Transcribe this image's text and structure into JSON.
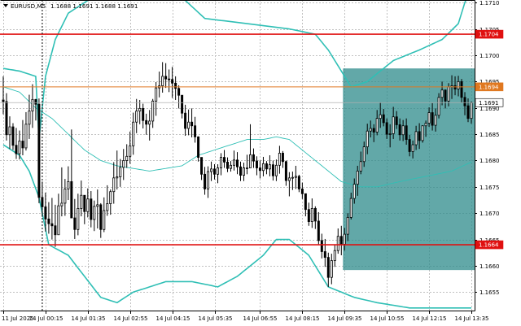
{
  "window": {
    "title_symbol": "EURUSD,M5",
    "title_prices": "1.1688 1.1691 1.1688 1.1691"
  },
  "colors": {
    "background": "#ffffff",
    "grid": "#c0c0c0",
    "candle": "#000000",
    "bollinger": "#2fbfb5",
    "moving_average": "#2fbfb5",
    "support_resistance": "#e01010",
    "level_orange": "#e07820",
    "current_price_line": "#b0b0b0",
    "highlight_box": "#2e8b8b"
  },
  "chart_data": {
    "type": "candlestick",
    "symbol": "EURUSD",
    "timeframe": "M5",
    "ylim": [
      1.16515,
      1.17105
    ],
    "y_ticks": [
      "1.1710",
      "1.1705",
      "1.1700",
      "1.1695",
      "1.1690",
      "1.1685",
      "1.1680",
      "1.1675",
      "1.1670",
      "1.1665",
      "1.1660",
      "1.1655"
    ],
    "x_ticks": [
      "11 Jul 2025",
      "14 Jul 00:15",
      "14 Jul 01:35",
      "14 Jul 02:55",
      "14 Jul 04:15",
      "14 Jul 05:35",
      "14 Jul 06:55",
      "14 Jul 08:15",
      "14 Jul 09:35",
      "14 Jul 10:55",
      "14 Jul 12:15",
      "14 Jul 13:35"
    ],
    "horizontal_levels": [
      {
        "price": 1.1704,
        "label": "1.1704",
        "style": "red"
      },
      {
        "price": 1.1694,
        "label": "1.1694",
        "style": "orange"
      },
      {
        "price": 1.1664,
        "label": "1.1664",
        "style": "red"
      },
      {
        "price": 1.1691,
        "label": "1.1691",
        "style": "current"
      }
    ],
    "highlight_zone": {
      "price_high": 1.16975,
      "price_low": 1.16592,
      "start_candle": 105,
      "end_candle": 145
    },
    "vertical_marker_candle": 11,
    "candles": [
      [
        1.16915,
        1.1696,
        1.16888,
        1.16912
      ],
      [
        1.16912,
        1.16928,
        1.16838,
        1.16849
      ],
      [
        1.16849,
        1.16884,
        1.16822,
        1.16864
      ],
      [
        1.16864,
        1.16871,
        1.1682,
        1.16829
      ],
      [
        1.16829,
        1.16862,
        1.16803,
        1.16813
      ],
      [
        1.16813,
        1.16857,
        1.16802,
        1.16837
      ],
      [
        1.16837,
        1.16877,
        1.1681,
        1.16824
      ],
      [
        1.16824,
        1.16892,
        1.16819,
        1.16869
      ],
      [
        1.16869,
        1.16925,
        1.16841,
        1.16894
      ],
      [
        1.16894,
        1.16945,
        1.16862,
        1.16916
      ],
      [
        1.16916,
        1.16917,
        1.16876,
        1.16907
      ],
      [
        1.16907,
        1.16918,
        1.16719,
        1.1673
      ],
      [
        1.1673,
        1.1676,
        1.16693,
        1.16712
      ],
      [
        1.16712,
        1.16739,
        1.16665,
        1.16689
      ],
      [
        1.16689,
        1.16721,
        1.16661,
        1.1668
      ],
      [
        1.1668,
        1.16729,
        1.1665,
        1.16676
      ],
      [
        1.16676,
        1.16716,
        1.16636,
        1.16659
      ],
      [
        1.16659,
        1.16737,
        1.16659,
        1.16714
      ],
      [
        1.16714,
        1.16787,
        1.16694,
        1.16719
      ],
      [
        1.16719,
        1.16765,
        1.16695,
        1.16746
      ],
      [
        1.16746,
        1.16789,
        1.16725,
        1.1676
      ],
      [
        1.1676,
        1.16859,
        1.16691,
        1.16691
      ],
      [
        1.16691,
        1.16727,
        1.16651,
        1.16669
      ],
      [
        1.16669,
        1.16737,
        1.16658,
        1.16709
      ],
      [
        1.16709,
        1.16762,
        1.16694,
        1.16734
      ],
      [
        1.16734,
        1.16734,
        1.16679,
        1.16703
      ],
      [
        1.16703,
        1.16747,
        1.16692,
        1.16727
      ],
      [
        1.16727,
        1.16742,
        1.16673,
        1.16688
      ],
      [
        1.16688,
        1.16724,
        1.16666,
        1.16713
      ],
      [
        1.16713,
        1.16745,
        1.16671,
        1.16716
      ],
      [
        1.16716,
        1.16719,
        1.16653,
        1.16669
      ],
      [
        1.16669,
        1.1673,
        1.16664,
        1.16705
      ],
      [
        1.16705,
        1.16753,
        1.16695,
        1.16718
      ],
      [
        1.16718,
        1.16745,
        1.16697,
        1.16741
      ],
      [
        1.16741,
        1.16797,
        1.16718,
        1.16767
      ],
      [
        1.16767,
        1.16819,
        1.16745,
        1.16769
      ],
      [
        1.16769,
        1.16803,
        1.1675,
        1.16787
      ],
      [
        1.16787,
        1.16822,
        1.16763,
        1.168
      ],
      [
        1.168,
        1.16831,
        1.16786,
        1.16808
      ],
      [
        1.16808,
        1.16855,
        1.16794,
        1.16828
      ],
      [
        1.16828,
        1.16891,
        1.16811,
        1.16873
      ],
      [
        1.16873,
        1.16917,
        1.16852,
        1.16894
      ],
      [
        1.16894,
        1.16915,
        1.16869,
        1.16899
      ],
      [
        1.16899,
        1.16908,
        1.16861,
        1.16876
      ],
      [
        1.16876,
        1.16889,
        1.16849,
        1.16869
      ],
      [
        1.16869,
        1.16896,
        1.16838,
        1.16875
      ],
      [
        1.16875,
        1.16917,
        1.16862,
        1.16913
      ],
      [
        1.16913,
        1.16949,
        1.16885,
        1.16938
      ],
      [
        1.16938,
        1.16969,
        1.1692,
        1.16942
      ],
      [
        1.16942,
        1.16987,
        1.16929,
        1.1696
      ],
      [
        1.1696,
        1.16985,
        1.16938,
        1.16955
      ],
      [
        1.16955,
        1.16973,
        1.1693,
        1.16954
      ],
      [
        1.16954,
        1.16978,
        1.16919,
        1.16947
      ],
      [
        1.16947,
        1.1696,
        1.16915,
        1.16937
      ],
      [
        1.16937,
        1.16943,
        1.16899,
        1.16924
      ],
      [
        1.16924,
        1.16924,
        1.1688,
        1.1689
      ],
      [
        1.1689,
        1.16906,
        1.16847,
        1.16861
      ],
      [
        1.16861,
        1.16897,
        1.16848,
        1.16873
      ],
      [
        1.16873,
        1.16899,
        1.16844,
        1.16866
      ],
      [
        1.16866,
        1.16883,
        1.16834,
        1.16845
      ],
      [
        1.16845,
        1.16846,
        1.16798,
        1.16806
      ],
      [
        1.16806,
        1.16806,
        1.16763,
        1.16774
      ],
      [
        1.16774,
        1.16788,
        1.16735,
        1.16746
      ],
      [
        1.16746,
        1.16789,
        1.16729,
        1.16779
      ],
      [
        1.16779,
        1.16798,
        1.16761,
        1.16784
      ],
      [
        1.16784,
        1.16793,
        1.16764,
        1.16774
      ],
      [
        1.16774,
        1.16793,
        1.16757,
        1.16786
      ],
      [
        1.16786,
        1.16814,
        1.16772,
        1.16806
      ],
      [
        1.16806,
        1.1682,
        1.16786,
        1.16797
      ],
      [
        1.16797,
        1.16806,
        1.16778,
        1.16785
      ],
      [
        1.16785,
        1.16799,
        1.16779,
        1.16791
      ],
      [
        1.16791,
        1.16819,
        1.16781,
        1.16801
      ],
      [
        1.16801,
        1.16816,
        1.16774,
        1.16788
      ],
      [
        1.16788,
        1.16798,
        1.16761,
        1.16772
      ],
      [
        1.16772,
        1.16796,
        1.16761,
        1.16786
      ],
      [
        1.16786,
        1.16811,
        1.16774,
        1.16786
      ],
      [
        1.16786,
        1.16869,
        1.16786,
        1.16811
      ],
      [
        1.16811,
        1.16823,
        1.16786,
        1.16799
      ],
      [
        1.16799,
        1.16808,
        1.16772,
        1.16786
      ],
      [
        1.16786,
        1.168,
        1.16766,
        1.16781
      ],
      [
        1.16781,
        1.16807,
        1.1677,
        1.16794
      ],
      [
        1.16794,
        1.16799,
        1.16774,
        1.16784
      ],
      [
        1.16784,
        1.1681,
        1.1677,
        1.16792
      ],
      [
        1.16792,
        1.168,
        1.16762,
        1.16771
      ],
      [
        1.16771,
        1.16802,
        1.16761,
        1.16791
      ],
      [
        1.16791,
        1.16828,
        1.16775,
        1.16814
      ],
      [
        1.16814,
        1.16818,
        1.16786,
        1.16798
      ],
      [
        1.16798,
        1.168,
        1.16752,
        1.16762
      ],
      [
        1.16762,
        1.16778,
        1.16732,
        1.16767
      ],
      [
        1.16767,
        1.16779,
        1.16744,
        1.16768
      ],
      [
        1.16768,
        1.1679,
        1.16746,
        1.1677
      ],
      [
        1.1677,
        1.16773,
        1.1674,
        1.16746
      ],
      [
        1.16746,
        1.16758,
        1.16727,
        1.16737
      ],
      [
        1.16737,
        1.16737,
        1.16694,
        1.16707
      ],
      [
        1.16707,
        1.1672,
        1.16676,
        1.16684
      ],
      [
        1.16684,
        1.16728,
        1.16672,
        1.16709
      ],
      [
        1.16709,
        1.16713,
        1.1667,
        1.16685
      ],
      [
        1.16685,
        1.16702,
        1.16641,
        1.16648
      ],
      [
        1.16648,
        1.16661,
        1.16614,
        1.16627
      ],
      [
        1.16627,
        1.16651,
        1.16598,
        1.16616
      ],
      [
        1.16616,
        1.16625,
        1.1656,
        1.16578
      ],
      [
        1.16578,
        1.16623,
        1.16565,
        1.1661
      ],
      [
        1.1661,
        1.16641,
        1.16598,
        1.16629
      ],
      [
        1.16629,
        1.16671,
        1.16623,
        1.16656
      ],
      [
        1.16656,
        1.16676,
        1.1662,
        1.16641
      ],
      [
        1.16641,
        1.16672,
        1.16629,
        1.1666
      ],
      [
        1.1666,
        1.167,
        1.16647,
        1.16692
      ],
      [
        1.16692,
        1.16739,
        1.16688,
        1.16728
      ],
      [
        1.16728,
        1.16766,
        1.16718,
        1.16755
      ],
      [
        1.16755,
        1.1679,
        1.16733,
        1.1678
      ],
      [
        1.1678,
        1.16817,
        1.16774,
        1.16798
      ],
      [
        1.16798,
        1.16836,
        1.16788,
        1.16826
      ],
      [
        1.16826,
        1.1687,
        1.16812,
        1.16856
      ],
      [
        1.16856,
        1.16876,
        1.16844,
        1.16861
      ],
      [
        1.16861,
        1.16869,
        1.16835,
        1.16854
      ],
      [
        1.16854,
        1.16896,
        1.16848,
        1.1688
      ],
      [
        1.1688,
        1.1691,
        1.16862,
        1.16887
      ],
      [
        1.16887,
        1.16898,
        1.16865,
        1.16872
      ],
      [
        1.16872,
        1.1688,
        1.16841,
        1.1685
      ],
      [
        1.1685,
        1.16869,
        1.16825,
        1.16851
      ],
      [
        1.16851,
        1.16902,
        1.16841,
        1.16883
      ],
      [
        1.16883,
        1.16894,
        1.1686,
        1.16868
      ],
      [
        1.16868,
        1.1688,
        1.16838,
        1.16849
      ],
      [
        1.16849,
        1.16877,
        1.16837,
        1.16866
      ],
      [
        1.16866,
        1.1688,
        1.1683,
        1.1684
      ],
      [
        1.1684,
        1.16849,
        1.16808,
        1.16817
      ],
      [
        1.16817,
        1.16838,
        1.16804,
        1.1683
      ],
      [
        1.1683,
        1.16866,
        1.1682,
        1.16855
      ],
      [
        1.16855,
        1.16871,
        1.16822,
        1.16838
      ],
      [
        1.16838,
        1.16867,
        1.16834,
        1.16866
      ],
      [
        1.16866,
        1.16876,
        1.16845,
        1.16871
      ],
      [
        1.16871,
        1.16901,
        1.16864,
        1.16891
      ],
      [
        1.16891,
        1.16909,
        1.16857,
        1.16867
      ],
      [
        1.16867,
        1.16899,
        1.16855,
        1.16886
      ],
      [
        1.16886,
        1.16928,
        1.1688,
        1.1692
      ],
      [
        1.1692,
        1.1695,
        1.16905,
        1.16934
      ],
      [
        1.16934,
        1.16935,
        1.16899,
        1.16913
      ],
      [
        1.16913,
        1.16947,
        1.16903,
        1.1694
      ],
      [
        1.1694,
        1.16962,
        1.16917,
        1.16942
      ],
      [
        1.16942,
        1.1696,
        1.16924,
        1.16936
      ],
      [
        1.16936,
        1.16961,
        1.16922,
        1.1695
      ],
      [
        1.1695,
        1.16955,
        1.1691,
        1.1692
      ],
      [
        1.1692,
        1.1693,
        1.16886,
        1.16904
      ],
      [
        1.16904,
        1.16918,
        1.16873,
        1.1688
      ],
      [
        1.1688,
        1.16912,
        1.1687,
        1.1691
      ]
    ],
    "bollinger_upper": [
      [
        0,
        1.16975
      ],
      [
        5,
        1.1697
      ],
      [
        10,
        1.1696
      ],
      [
        11,
        1.1684
      ],
      [
        13,
        1.1696
      ],
      [
        16,
        1.1703
      ],
      [
        20,
        1.1708
      ],
      [
        30,
        1.1712
      ],
      [
        40,
        1.1714
      ],
      [
        50,
        1.1713
      ],
      [
        55,
        1.1711
      ],
      [
        62,
        1.1707
      ],
      [
        75,
        1.1706
      ],
      [
        88,
        1.1705
      ],
      [
        96,
        1.1704
      ],
      [
        100,
        1.1701
      ],
      [
        104,
        1.1697
      ],
      [
        107,
        1.1694
      ],
      [
        112,
        1.1695
      ],
      [
        120,
        1.1699
      ],
      [
        128,
        1.1701
      ],
      [
        135,
        1.1703
      ],
      [
        140,
        1.1706
      ],
      [
        142,
        1.171
      ],
      [
        145,
        1.1714
      ]
    ],
    "bollinger_lower": [
      [
        0,
        1.1683
      ],
      [
        5,
        1.1681
      ],
      [
        8,
        1.1678
      ],
      [
        11,
        1.1673
      ],
      [
        14,
        1.1664
      ],
      [
        20,
        1.1662
      ],
      [
        25,
        1.1658
      ],
      [
        30,
        1.1654
      ],
      [
        35,
        1.1653
      ],
      [
        40,
        1.1655
      ],
      [
        50,
        1.1657
      ],
      [
        58,
        1.1657
      ],
      [
        66,
        1.1656
      ],
      [
        72,
        1.1658
      ],
      [
        80,
        1.1662
      ],
      [
        84,
        1.1665
      ],
      [
        88,
        1.1665
      ],
      [
        94,
        1.1662
      ],
      [
        100,
        1.1656
      ],
      [
        108,
        1.1654
      ],
      [
        115,
        1.1653
      ],
      [
        125,
        1.1652
      ],
      [
        135,
        1.1652
      ],
      [
        145,
        1.1652
      ]
    ],
    "moving_average": [
      [
        0,
        1.1694
      ],
      [
        5,
        1.1693
      ],
      [
        10,
        1.169
      ],
      [
        15,
        1.1688
      ],
      [
        20,
        1.1685
      ],
      [
        25,
        1.1682
      ],
      [
        30,
        1.168
      ],
      [
        35,
        1.1679
      ],
      [
        40,
        1.16785
      ],
      [
        45,
        1.1678
      ],
      [
        50,
        1.16785
      ],
      [
        55,
        1.1679
      ],
      [
        60,
        1.1681
      ],
      [
        65,
        1.1682
      ],
      [
        70,
        1.1683
      ],
      [
        75,
        1.1684
      ],
      [
        80,
        1.1684
      ],
      [
        84,
        1.16845
      ],
      [
        88,
        1.1684
      ],
      [
        92,
        1.1682
      ],
      [
        96,
        1.168
      ],
      [
        100,
        1.1678
      ],
      [
        104,
        1.1676
      ],
      [
        110,
        1.1675
      ],
      [
        115,
        1.1675
      ],
      [
        122,
        1.1676
      ],
      [
        130,
        1.1677
      ],
      [
        138,
        1.1678
      ],
      [
        145,
        1.168
      ]
    ]
  }
}
